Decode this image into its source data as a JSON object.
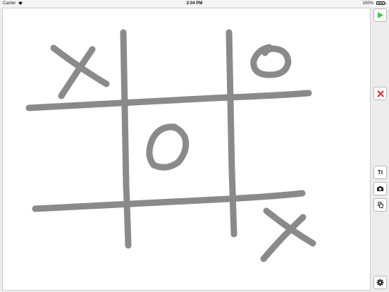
{
  "status_bar": {
    "carrier": "Carrier",
    "time": "2:04 PM",
    "battery": "100%"
  },
  "toolbar": {
    "text_label": "Tt"
  },
  "colors": {
    "stroke": "#8a8a8a",
    "play": "#3cc84a",
    "close": "#e0332f"
  },
  "icons": [
    "play-icon",
    "close-icon",
    "camera-icon",
    "stickers-icon",
    "gear-icon"
  ]
}
